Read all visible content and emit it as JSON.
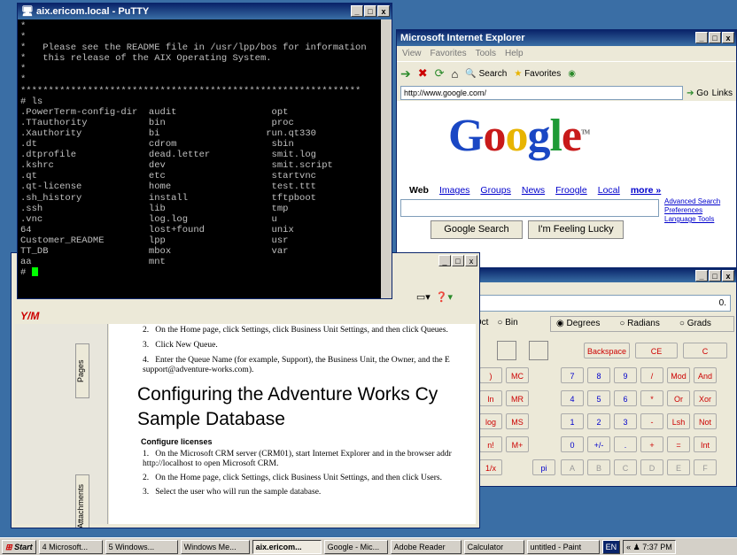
{
  "putty": {
    "title": "aix.ericom.local - PuTTY",
    "lines": [
      "*",
      "*",
      "*   Please see the README file in /usr/lpp/bos for information",
      "*   this release of the AIX Operating System.",
      "*",
      "*",
      "*************************************************************",
      "# ls",
      ".PowerTerm-config-dir  audit                 opt",
      ".TTauthority           bin                   proc",
      ".Xauthority            bi                   run.qt330",
      ".dt                    cdrom                 sbin",
      ".dtprofile             dead.letter           smit.log",
      ".kshrc                 dev                   smit.script",
      ".qt                    etc                   startvnc",
      ".qt-license            home                  test.ttt",
      ".sh_history            install               tftpboot",
      ".ssh                   lib                   tmp",
      ".vnc                   log.log               u",
      "64                     lost+found            unix",
      "Customer_README        lpp                   usr",
      "TT_DB                  mbox                  var",
      "aa                     mnt"
    ],
    "prompt": "# "
  },
  "ie": {
    "title": "Microsoft Internet Explorer",
    "menu": [
      "View",
      "Favorites",
      "Tools",
      "Help"
    ],
    "toolbar": {
      "search": "Search",
      "favorites": "Favorites"
    },
    "address": "http://www.google.com/",
    "go": "Go",
    "links": "Links",
    "google": {
      "logo": [
        "G",
        "o",
        "o",
        "g",
        "l",
        "e"
      ],
      "tm": "TM",
      "nav": [
        "Web",
        "Images",
        "Groups",
        "News",
        "Froogle",
        "Local",
        "more »"
      ],
      "search_button": "Google Search",
      "lucky_button": "I'm Feeling Lucky",
      "side_links": [
        "Advanced Search",
        "Preferences",
        "Language Tools"
      ]
    }
  },
  "calculator": {
    "display": "0.",
    "base_labels": [
      "Oct",
      "Bin"
    ],
    "angle_labels": [
      "Degrees",
      "Radians",
      "Grads"
    ],
    "top_buttons": [
      "Backspace",
      "CE",
      "C"
    ],
    "rows": [
      [
        ")",
        "MC",
        "7",
        "8",
        "9",
        "/",
        "Mod",
        "And"
      ],
      [
        "ln",
        "MR",
        "4",
        "5",
        "6",
        "*",
        "Or",
        "Xor"
      ],
      [
        "log",
        "MS",
        "1",
        "2",
        "3",
        "-",
        "Lsh",
        "Not"
      ],
      [
        "n!",
        "M+",
        "0",
        "+/-",
        ".",
        "+",
        "=",
        "Int"
      ],
      [
        "1/x",
        "",
        "pi",
        "A",
        "B",
        "C",
        "D",
        "E",
        "F"
      ]
    ]
  },
  "adobe": {
    "tabs": [
      "Pages",
      "Attachments"
    ],
    "steps_top": [
      {
        "num": "2.",
        "text": "On the Home page, click Settings, click Business Unit Settings, and then click Queues."
      },
      {
        "num": "3.",
        "text": "Click New Queue."
      },
      {
        "num": "4.",
        "text": "Enter the Queue Name (for example, Support), the Business Unit, the Owner, and the E support@adventure-works.com)."
      }
    ],
    "heading": "Configuring the Adventure Works Cy Sample Database",
    "subheading": "Configure licenses",
    "steps_bottom": [
      {
        "num": "1.",
        "text": "On the Microsoft CRM server (CRM01), start Internet Explorer and in the browser addr http://localhost to open Microsoft CRM."
      },
      {
        "num": "2.",
        "text": "On the Home page, click Settings, click Business Unit Settings, and then click Users."
      },
      {
        "num": "3.",
        "text": "Select the user who will run the sample database."
      }
    ]
  },
  "taskbar": {
    "start": "Start",
    "items": [
      "4 Microsoft...",
      "5 Windows...",
      "Windows Me...",
      "aix.ericom...",
      "Google - Mic...",
      "Adobe Reader",
      "Calculator",
      "untitled - Paint"
    ],
    "lang": "EN",
    "clock": "7:37 PM"
  }
}
